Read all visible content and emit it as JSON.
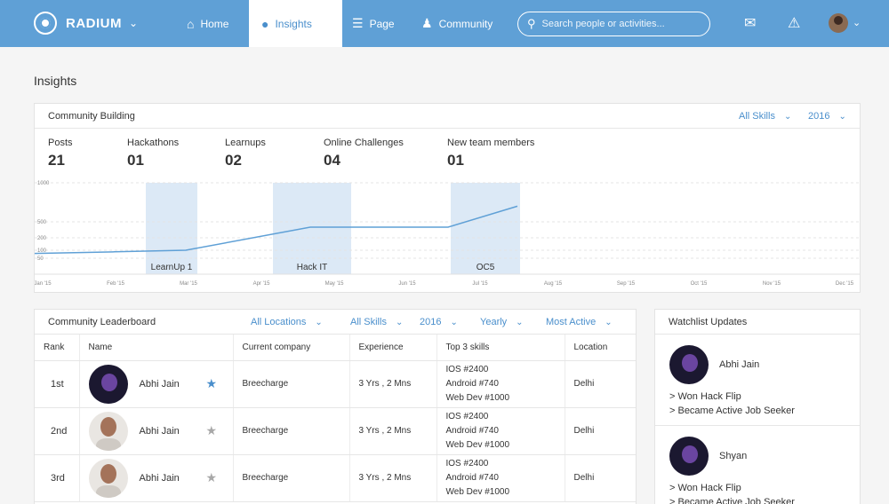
{
  "app": {
    "name": "RADIUM"
  },
  "nav": {
    "tabs": [
      {
        "label": "Home",
        "icon": "home-icon"
      },
      {
        "label": "Insights",
        "icon": "insights-icon",
        "active": true
      },
      {
        "label": "Page",
        "icon": "page-icon"
      },
      {
        "label": "Community",
        "icon": "community-icon"
      }
    ],
    "search_placeholder": "Search people or activities..."
  },
  "page_title": "Insights",
  "community_building": {
    "title": "Community Building",
    "filter_skills": "All Skills",
    "filter_year": "2016",
    "stats": [
      {
        "label": "Posts",
        "value": "21"
      },
      {
        "label": "Hackathons",
        "value": "01"
      },
      {
        "label": "Learnups",
        "value": "02"
      },
      {
        "label": "Online Challenges",
        "value": "04"
      },
      {
        "label": "New team members",
        "value": "01"
      }
    ]
  },
  "chart_data": {
    "type": "line",
    "x": [
      "Jan '15",
      "Feb '15",
      "Mar '15",
      "Apr '15",
      "May '15",
      "Jun '15",
      "Jul '15",
      "Aug '15",
      "Sep '15",
      "Oct '15",
      "Nov '15",
      "Dec '15"
    ],
    "series": [
      {
        "values": [
          80,
          90,
          100,
          400,
          400,
          400,
          700
        ]
      }
    ],
    "y_ticks": [
      "1000",
      "500",
      "200",
      "100",
      "50"
    ],
    "events": [
      {
        "label": "LearnUp 1",
        "from": "Feb '15",
        "to": "Mar '15"
      },
      {
        "label": "Hack IT",
        "from": "Apr '15",
        "to": "May '15"
      },
      {
        "label": "OC5",
        "from": "Jul '15",
        "to": "Jul '15"
      }
    ],
    "grid": true,
    "colors": {
      "line": "#5fa0d6",
      "event": "#dce9f6"
    }
  },
  "leaderboard": {
    "title": "Community Leaderboard",
    "filters": [
      "All Locations",
      "All Skills",
      "2016",
      "Yearly",
      "Most Active"
    ],
    "columns": [
      "Rank",
      "Name",
      "Current company",
      "Experience",
      "Top 3 skills",
      "Location"
    ],
    "rows": [
      {
        "rank": "1st",
        "name": "Abhi Jain",
        "starred": true,
        "company": "Breecharge",
        "experience": "3 Yrs , 2 Mns",
        "skills": [
          "IOS  #2400",
          "Android  #740",
          "Web Dev  #1000"
        ],
        "location": "Delhi"
      },
      {
        "rank": "2nd",
        "name": "Abhi Jain",
        "starred": false,
        "company": "Breecharge",
        "experience": "3 Yrs , 2 Mns",
        "skills": [
          "IOS  #2400",
          "Android  #740",
          "Web Dev  #1000"
        ],
        "location": "Delhi"
      },
      {
        "rank": "3rd",
        "name": "Abhi Jain",
        "starred": false,
        "company": "Breecharge",
        "experience": "3 Yrs , 2 Mns",
        "skills": [
          "IOS  #2400",
          "Android  #740",
          "Web Dev  #1000"
        ],
        "location": "Delhi"
      }
    ]
  },
  "watchlist": {
    "title": "Watchlist Updates",
    "items": [
      {
        "name": "Abhi Jain",
        "activities": [
          "> Won Hack Flip",
          "> Became Active Job Seeker"
        ]
      },
      {
        "name": "Shyan",
        "activities": [
          "> Won Hack Flip",
          "> Became Active Job Seeker"
        ]
      }
    ]
  },
  "colors": {
    "accent": "#5fa0d6",
    "link": "#4a8fcc",
    "star_on": "#4a8fcc",
    "star_off": "#a8a8a8"
  }
}
